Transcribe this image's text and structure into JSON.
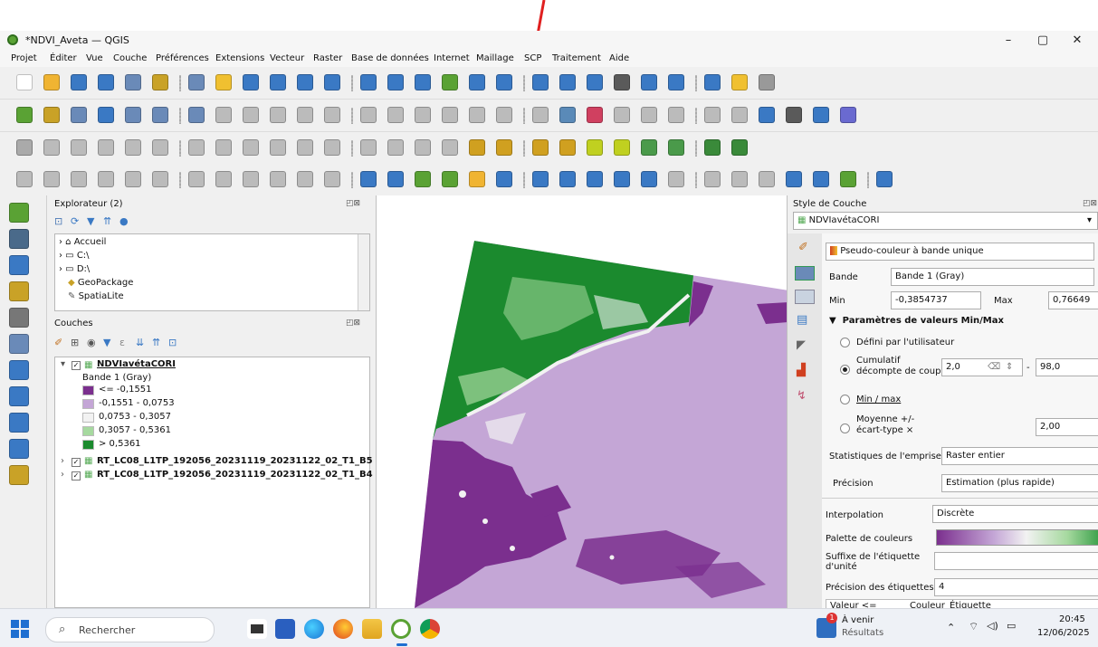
{
  "window": {
    "title": "*NDVI_Aveta — QGIS",
    "minimize": "–",
    "maximize": "▢",
    "close": "✕"
  },
  "menu": [
    "Projet",
    "Éditer",
    "Vue",
    "Couche",
    "Préférences",
    "Extensions",
    "Vecteur",
    "Raster",
    "Base de données",
    "Internet",
    "Maillage",
    "SCP",
    "Traitement",
    "Aide"
  ],
  "browser": {
    "title": "Explorateur (2)",
    "items": [
      "Accueil",
      "C:\\",
      "D:\\",
      "GeoPackage",
      "SpatiaLite"
    ]
  },
  "layers": {
    "title": "Couches",
    "main_layer": "NDVIavétaCORI",
    "band": "Bande 1 (Gray)",
    "legend": [
      {
        "label": "<= -0,1551",
        "color": "#7b2f8e"
      },
      {
        "label": "-0,1551 - 0,0753",
        "color": "#c4a6d6"
      },
      {
        "label": "0,0753 - 0,3057",
        "color": "#f2f2f2"
      },
      {
        "label": "0,3057 - 0,5361",
        "color": "#a6d99f"
      },
      {
        "label": "> 0,5361",
        "color": "#1b8a2e"
      }
    ],
    "other_layers": [
      "RT_LC08_L1TP_192056_20231119_20231122_02_T1_B5",
      "RT_LC08_L1TP_192056_20231119_20231122_02_T1_B4"
    ]
  },
  "style": {
    "title": "Style de Couche",
    "layer": "NDVIavétaCORI",
    "renderer": "Pseudo-couleur à bande unique",
    "band_label": "Bande",
    "band_value": "Bande 1 (Gray)",
    "min_label": "Min",
    "min_value": "-0,3854737",
    "max_label": "Max",
    "max_value": "0,76649",
    "minmax_section": "Paramètres de valeurs Min/Max",
    "opt_user": "Défini par l'utilisateur",
    "opt_cumul_1": "Cumulatif",
    "opt_cumul_2": "décompte de coupe",
    "cumul_low": "2,0",
    "cumul_dash": "-",
    "cumul_high": "98,0",
    "opt_minmax": "Min / max",
    "opt_mean_1": "Moyenne +/-",
    "opt_mean_2": "écart-type ×",
    "mean_value": "2,00",
    "stats_label": "Statistiques de l'emprise",
    "stats_value": "Raster entier",
    "precision_label": "Précision",
    "precision_value": "Estimation (plus rapide)",
    "interp_label": "Interpolation",
    "interp_value": "Discrète",
    "palette_label": "Palette de couleurs",
    "unit_suffix_1": "Suffixe de l'étiquette",
    "unit_suffix_2": "d'unité",
    "label_precision_label": "Précision des étiquettes",
    "label_precision_value": "4",
    "col_value": "Valeur <=",
    "col_color": "Couleur",
    "col_label": "Étiquette"
  },
  "taskbar": {
    "search": "Rechercher",
    "notif_title": "À venir",
    "notif_sub": "Résultats",
    "notif_badge": "1",
    "time": "20:45",
    "date": "12/06/2025"
  },
  "colors": {
    "ndvi_low": "#7b2f8e",
    "ndvi_lowmid": "#c4a6d6",
    "ndvi_mid": "#f2f2f2",
    "ndvi_midhigh": "#a6d99f",
    "ndvi_high": "#1b8a2e",
    "annotation_arrow": "#e02020"
  }
}
